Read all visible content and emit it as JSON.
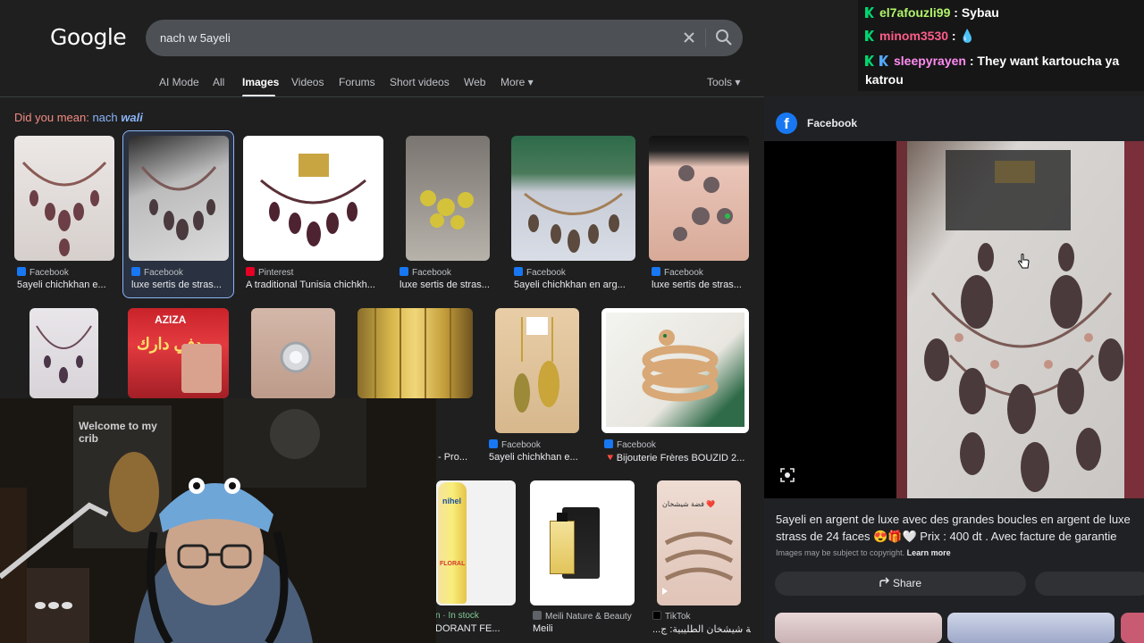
{
  "app": {
    "logo": "Google"
  },
  "search": {
    "query": "nach w 5ayeli"
  },
  "tabs": [
    {
      "label": "AI Mode"
    },
    {
      "label": "All"
    },
    {
      "label": "Images"
    },
    {
      "label": "Videos"
    },
    {
      "label": "Forums"
    },
    {
      "label": "Short videos"
    },
    {
      "label": "Web"
    },
    {
      "label": "More ▾"
    }
  ],
  "tools_label": "Tools ▾",
  "did_you_mean": {
    "prefix": "Did you mean: ",
    "plain": "nach ",
    "bold": "wali"
  },
  "results": [
    {
      "source": "Facebook",
      "title": "5ayeli chichkhan e...",
      "fav": "#1877f2"
    },
    {
      "source": "Facebook",
      "title": "luxe sertis de stras...",
      "fav": "#1877f2"
    },
    {
      "source": "Pinterest",
      "title": "A traditional Tunisia chichkh...",
      "fav": "#e60023"
    },
    {
      "source": "Facebook",
      "title": "luxe sertis de stras...",
      "fav": "#1877f2"
    },
    {
      "source": "Facebook",
      "title": "5ayeli chichkhan en arg...",
      "fav": "#1877f2"
    },
    {
      "source": "Facebook",
      "title": "luxe sertis de stras...",
      "fav": "#1877f2"
    },
    {
      "source": "",
      "title": "- Pro...",
      "fav": ""
    },
    {
      "source": "Facebook",
      "title": "5ayeli chichkhan e...",
      "fav": "#1877f2"
    },
    {
      "source": "Facebook",
      "title": "🔻Bijouterie Frères BOUZID 2...",
      "fav": "#1877f2"
    },
    {
      "source": "n · In stock",
      "title": "DORANT FE...",
      "fav": ""
    },
    {
      "source": "Meili Nature & Beauty",
      "title": "Meili",
      "fav": "#5f6368"
    },
    {
      "source": "TikTok",
      "title": "...سباعة شيشخان الطليبية: ج",
      "fav": "#000000"
    }
  ],
  "thumb_texts": {
    "aziza": "AZIZA",
    "arabic_promo": "دفي دارك",
    "nihel": "nihel",
    "floral": "FLORAL",
    "tiktok_caption": "فضة شيشخان ❤️"
  },
  "preview": {
    "source": "Facebook",
    "description_line1": "5ayeli en argent de luxe avec des grandes boucles en argent de luxe",
    "description_line2": "strass de 24 faces 😍🎁🤍 Prix : 400 dt . Avec facture de garantie",
    "copyright_prefix": "Images may be subject to copyright. ",
    "learn_more": "Learn more",
    "share_label": "Share"
  },
  "chat": [
    {
      "user": "el7afouzli99",
      "message": "Sybau"
    },
    {
      "user": "minom3530",
      "message": "💧"
    },
    {
      "user": "sleepyrayen",
      "message": "They want kartoucha ya"
    },
    {
      "user": "",
      "message": "katrou"
    }
  ],
  "webcam": {
    "poster_text": "Welcome to my crib"
  },
  "colors": {
    "background": "#1f1f1f",
    "link": "#8ab4f8",
    "accent_red": "#f28b82",
    "chat_user": "#b1f56b",
    "facebook": "#1877f2"
  }
}
